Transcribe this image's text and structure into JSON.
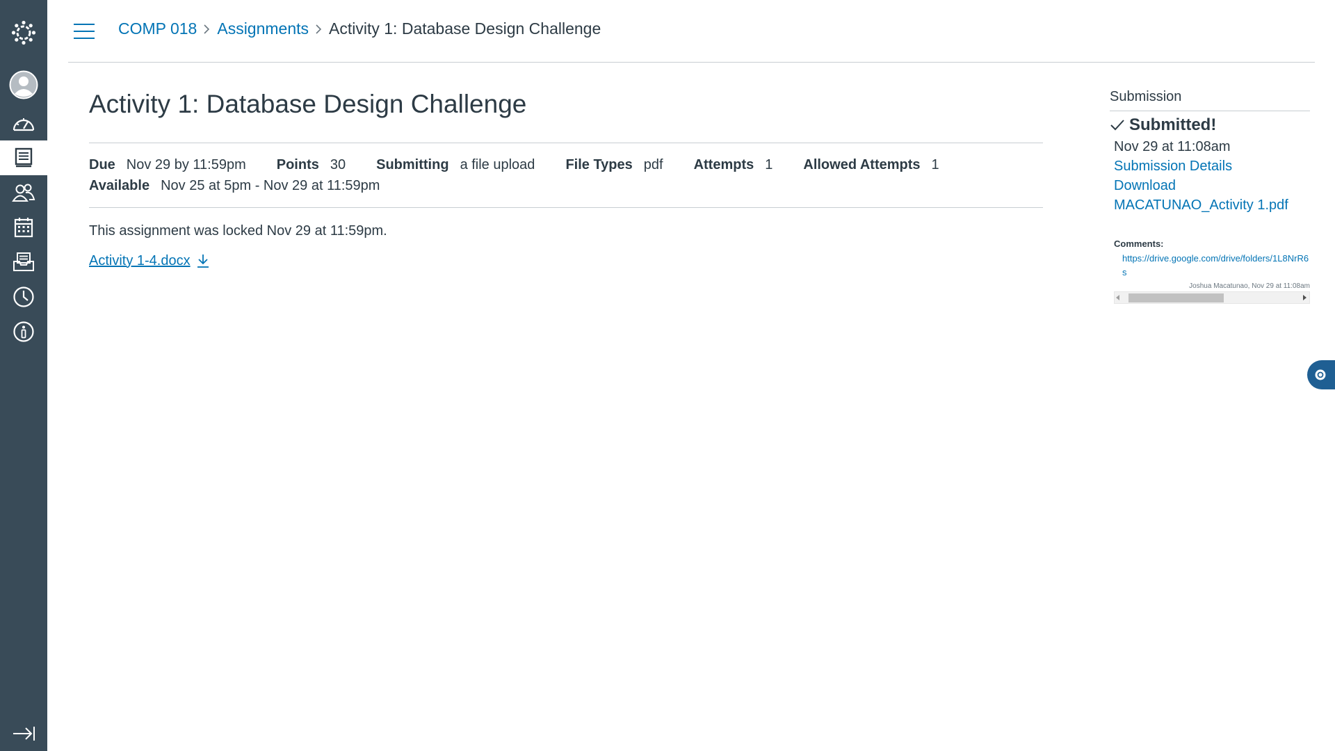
{
  "nav": {
    "items": [
      {
        "name": "logo",
        "icon": "canvas-logo-icon"
      },
      {
        "name": "account",
        "icon": "user-avatar-icon"
      },
      {
        "name": "dashboard",
        "icon": "dashboard-gauge-icon"
      },
      {
        "name": "courses",
        "icon": "book-icon"
      },
      {
        "name": "groups",
        "icon": "groups-icon"
      },
      {
        "name": "calendar",
        "icon": "calendar-icon"
      },
      {
        "name": "inbox",
        "icon": "inbox-icon"
      },
      {
        "name": "history",
        "icon": "clock-icon"
      },
      {
        "name": "help",
        "icon": "info-icon"
      }
    ],
    "collapse_icon": "collapse-arrow-icon",
    "colors": {
      "bg": "#394b58",
      "active_bg": "#ffffff",
      "active_icon": "#2d3b45",
      "icon": "#ffffff"
    }
  },
  "breadcrumb": {
    "course": "COMP 018",
    "section": "Assignments",
    "current": "Activity 1: Database Design Challenge"
  },
  "assignment": {
    "title": "Activity 1: Database Design Challenge",
    "due_label": "Due",
    "due_value": "Nov 29 by 11:59pm",
    "points_label": "Points",
    "points_value": "30",
    "submitting_label": "Submitting",
    "submitting_value": "a file upload",
    "filetypes_label": "File Types",
    "filetypes_value": "pdf",
    "attempts_label": "Attempts",
    "attempts_value": "1",
    "allowed_label": "Allowed Attempts",
    "allowed_value": "1",
    "available_label": "Available",
    "available_value": "Nov 25 at 5pm - Nov 29 at 11:59pm",
    "locked_text": "This assignment was locked Nov 29 at 11:59pm.",
    "attachment": "Activity 1-4.docx"
  },
  "submission": {
    "heading": "Submission",
    "status": "Submitted!",
    "date": "Nov 29 at 11:08am",
    "details_link": "Submission Details",
    "download_link": "Download",
    "file_link": "MACATUNAO_Activity 1.pdf",
    "comments_label": "Comments:",
    "comment_text": "https://drive.google.com/drive/folders/1L8NrR6s",
    "comment_author": "Joshua Macatunao, Nov 29 at 11:08am"
  },
  "accent": "#0374b5"
}
